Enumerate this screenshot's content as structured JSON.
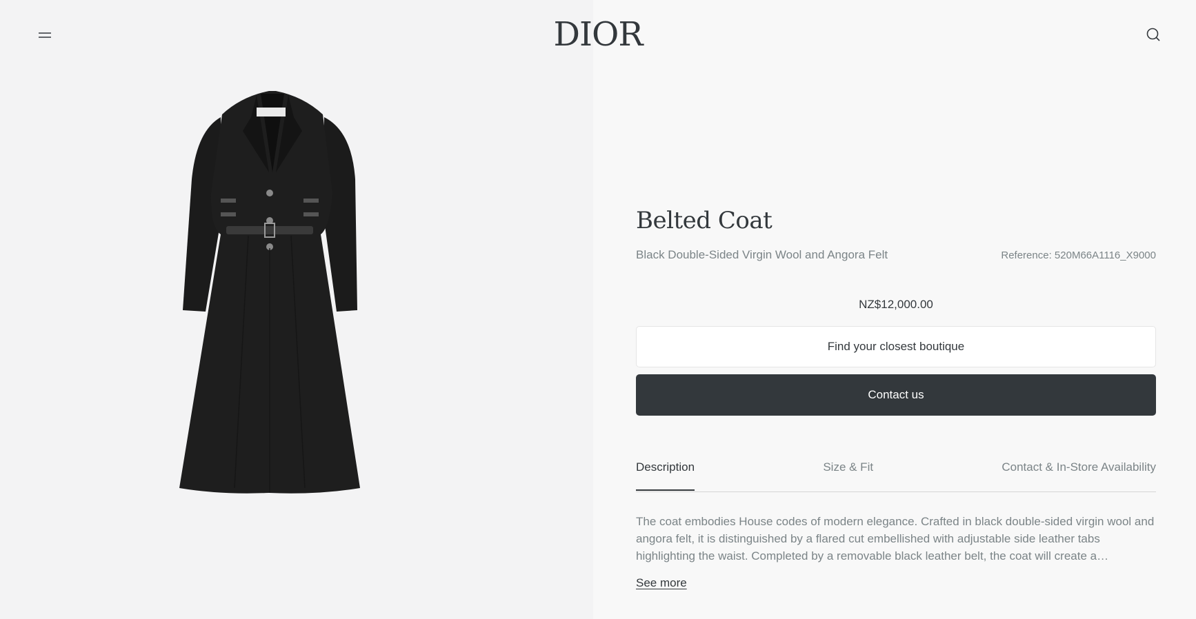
{
  "header": {
    "logo_text": "DIOR",
    "menu_icon": "menu-icon",
    "search_icon": "search-icon"
  },
  "product": {
    "title": "Belted Coat",
    "subtitle": "Black Double-Sided Virgin Wool and Angora Felt",
    "reference": "Reference: 520M66A1116_X9000",
    "price": "NZ$12,000.00",
    "image_alt": "Black belted coat"
  },
  "actions": {
    "boutique_label": "Find your closest boutique",
    "contact_label": "Contact us"
  },
  "tabs": [
    {
      "label": "Description",
      "active": true
    },
    {
      "label": "Size & Fit",
      "active": false
    },
    {
      "label": "Contact & In-Store Availability",
      "active": false
    }
  ],
  "description": {
    "text": "The coat embodies House codes of modern elegance. Crafted in black double-sided virgin wool and angora felt, it is distinguished by a flared cut embellished with adjustable side leather tabs highlighting the waist. Completed by a removable black leather belt, the coat will create a…",
    "see_more_label": "See more"
  },
  "colors": {
    "left_bg": "#f3f3f4",
    "right_bg": "#f8f8f8",
    "primary": "#33383c",
    "muted": "#7b8487"
  }
}
